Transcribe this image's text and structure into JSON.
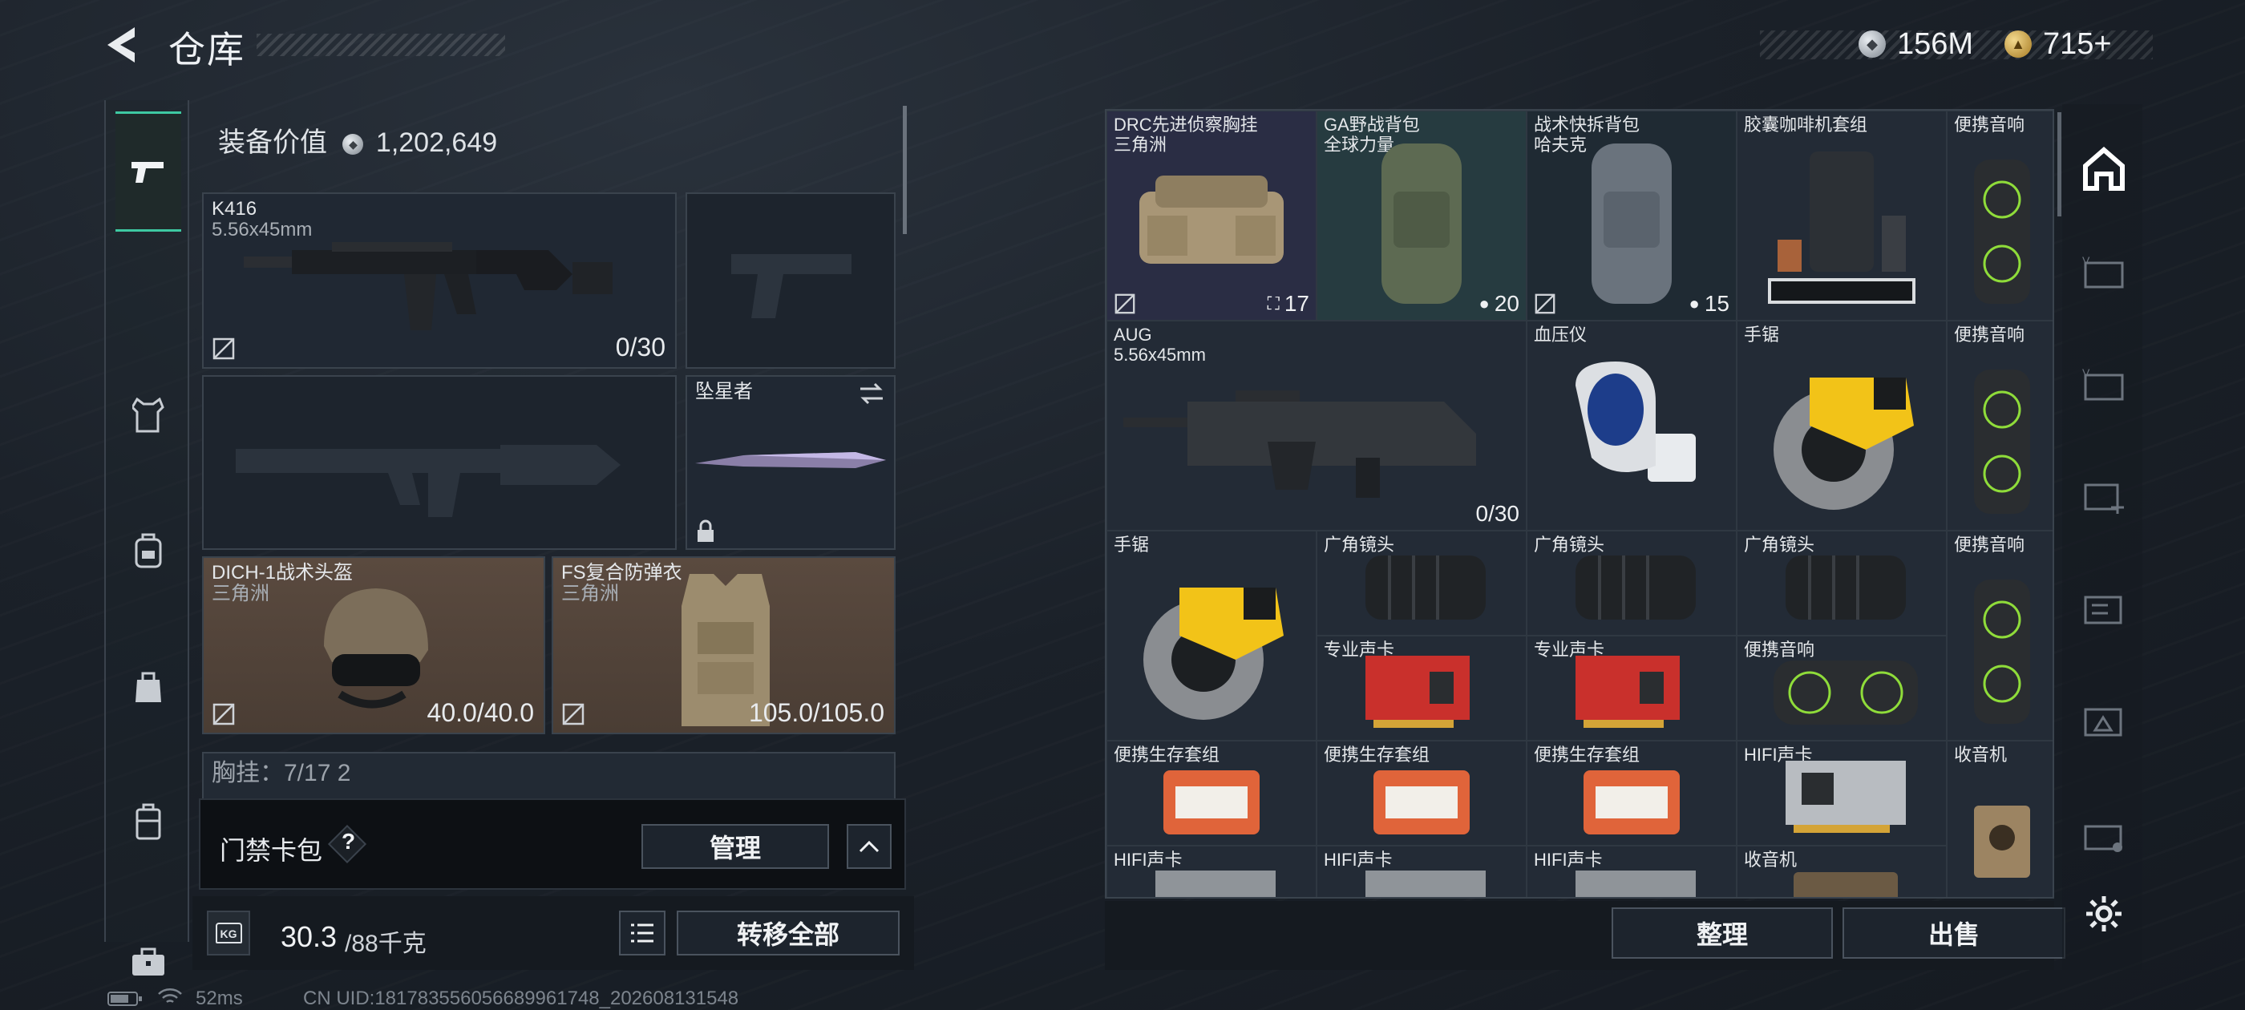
{
  "header": {
    "title": "仓库",
    "back_icon": "back-arrow-icon"
  },
  "currency": {
    "silver": "156M",
    "gold": "715+"
  },
  "sidebar": {
    "items": [
      {
        "name": "weapon",
        "icon": "pistol-icon",
        "active": true
      },
      {
        "name": "armor",
        "icon": "vest-icon"
      },
      {
        "name": "backpack",
        "icon": "backpack-icon"
      },
      {
        "name": "bag",
        "icon": "bag-icon"
      },
      {
        "name": "case",
        "icon": "case-icon"
      },
      {
        "name": "toolbox",
        "icon": "toolbox-icon"
      }
    ]
  },
  "equipment": {
    "value_label": "装备价值",
    "value": "1,202,649",
    "primary": {
      "name": "K416",
      "caliber": "5.56x45mm",
      "ammo": "0/30"
    },
    "melee": {
      "name": "坠星者"
    },
    "helmet": {
      "name": "DICH-1战术头盔",
      "origin": "三角洲",
      "durability": "40.0/40.0"
    },
    "armor": {
      "name": "FS复合防弹衣",
      "origin": "三角洲",
      "durability": "105.0/105.0"
    },
    "chest_partial": "胸挂：7/17 2",
    "keycard": {
      "label": "门禁卡包",
      "help": "?",
      "manage_label": "管理"
    },
    "weight": {
      "current": "30.3",
      "max": "/88千克",
      "badge": "KG"
    },
    "transfer_all": "转移全部"
  },
  "stash": {
    "items": [
      {
        "name": "DRC先进侦察胸挂",
        "sub": "三角洲",
        "count": "17"
      },
      {
        "name": "GA野战背包",
        "sub": "全球力量",
        "count": "20"
      },
      {
        "name": "战术快拆背包",
        "sub": "哈夫克",
        "count": "15"
      },
      {
        "name": "胶囊咖啡机套组"
      },
      {
        "name": "便携音响"
      },
      {
        "name": "AUG",
        "sub": "5.56x45mm",
        "count": "0/30"
      },
      {
        "name": "血压仪"
      },
      {
        "name": "手锯"
      },
      {
        "name": "便携音响"
      },
      {
        "name": "手锯"
      },
      {
        "name": "广角镜头"
      },
      {
        "name": "广角镜头"
      },
      {
        "name": "广角镜头"
      },
      {
        "name": "便携音响"
      },
      {
        "name": "专业声卡"
      },
      {
        "name": "专业声卡"
      },
      {
        "name": "便携音响"
      },
      {
        "name": "便携生存套组"
      },
      {
        "name": "便携生存套组"
      },
      {
        "name": "便携生存套组"
      },
      {
        "name": "HIFI声卡"
      },
      {
        "name": "收音机"
      },
      {
        "name": "HIFI声卡"
      },
      {
        "name": "HIFI声卡"
      },
      {
        "name": "HIFI声卡"
      },
      {
        "name": "收音机"
      }
    ],
    "sort_label": "整理",
    "sell_label": "出售"
  },
  "status": {
    "ping": "52ms",
    "uid": "CN UID:181783556056689961748_202608131548"
  }
}
